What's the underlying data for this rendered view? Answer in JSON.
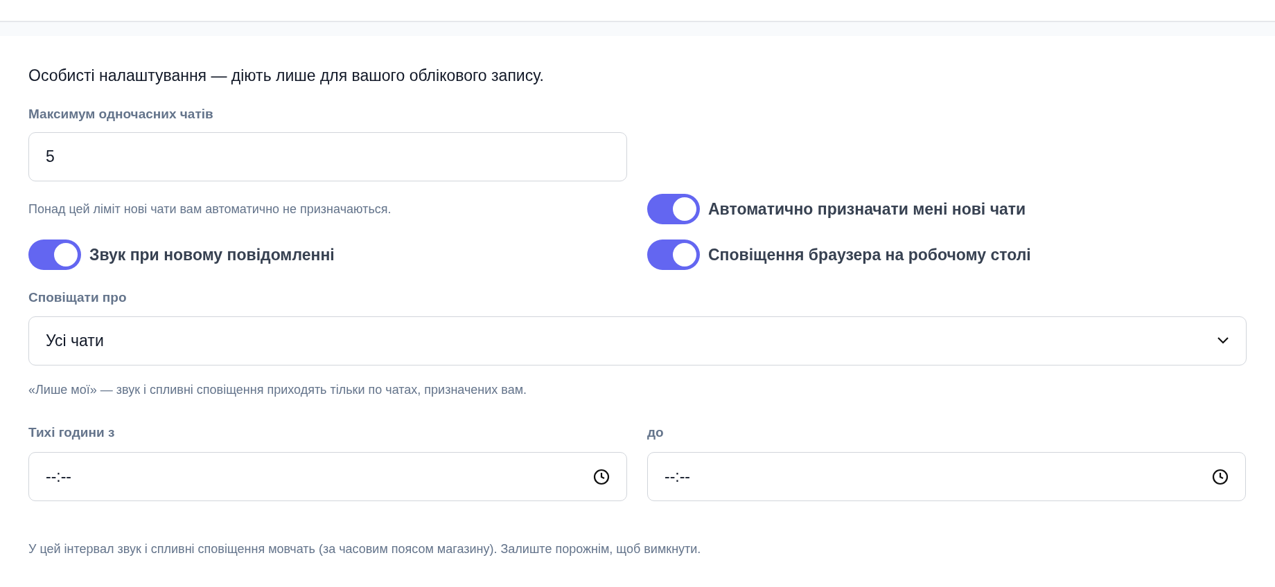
{
  "intro": "Особисті налаштування — діють лише для вашого облікового запису.",
  "max_chats": {
    "label": "Максимум одночасних чатів",
    "value": "5",
    "hint": "Понад цей ліміт нові чати вам автоматично не призначаються."
  },
  "toggles": [
    {
      "label": "Автоматично призначати мені нові чати",
      "on": true
    },
    {
      "label": "Звук при новому повідомленні",
      "on": true
    },
    {
      "label": "Сповіщення браузера на робочому столі",
      "on": true
    }
  ],
  "notify_about": {
    "label": "Сповіщати про",
    "value": "Усі чати",
    "hint": "«Лише мої» — звук і спливні сповіщення приходять тільки по чатах, призначених вам."
  },
  "quiet_hours": {
    "from_label": "Тихі години з",
    "from_value": "--:--",
    "to_label": "до",
    "to_value": "--:--",
    "hint": "У цей інтервал звук і спливні сповіщення мовчать (за часовим поясом магазину). Залиште порожнім, щоб вимкнути."
  }
}
